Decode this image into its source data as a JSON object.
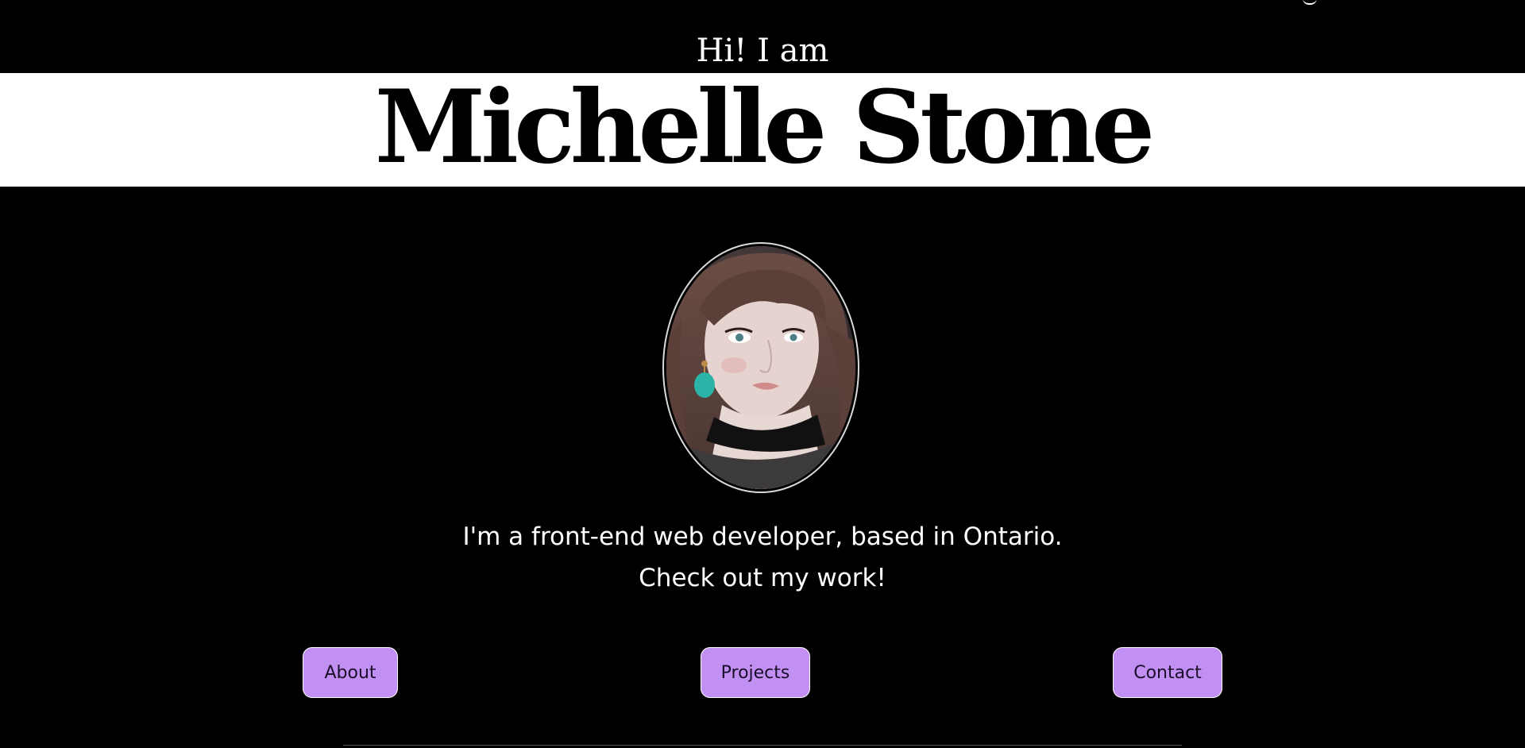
{
  "hero": {
    "greeting": "Hi! I am",
    "name": "Michelle Stone",
    "portrait_alt": "portrait photo"
  },
  "intro": {
    "line1": "I'm a front-end web developer, based in Ontario.",
    "line2": "Check out my work!"
  },
  "nav_buttons": {
    "about": "About",
    "projects": "Projects",
    "contact": "Contact"
  },
  "colors": {
    "background": "#000000",
    "name_band": "#ffffff",
    "button_accent": "#c28ff2"
  }
}
